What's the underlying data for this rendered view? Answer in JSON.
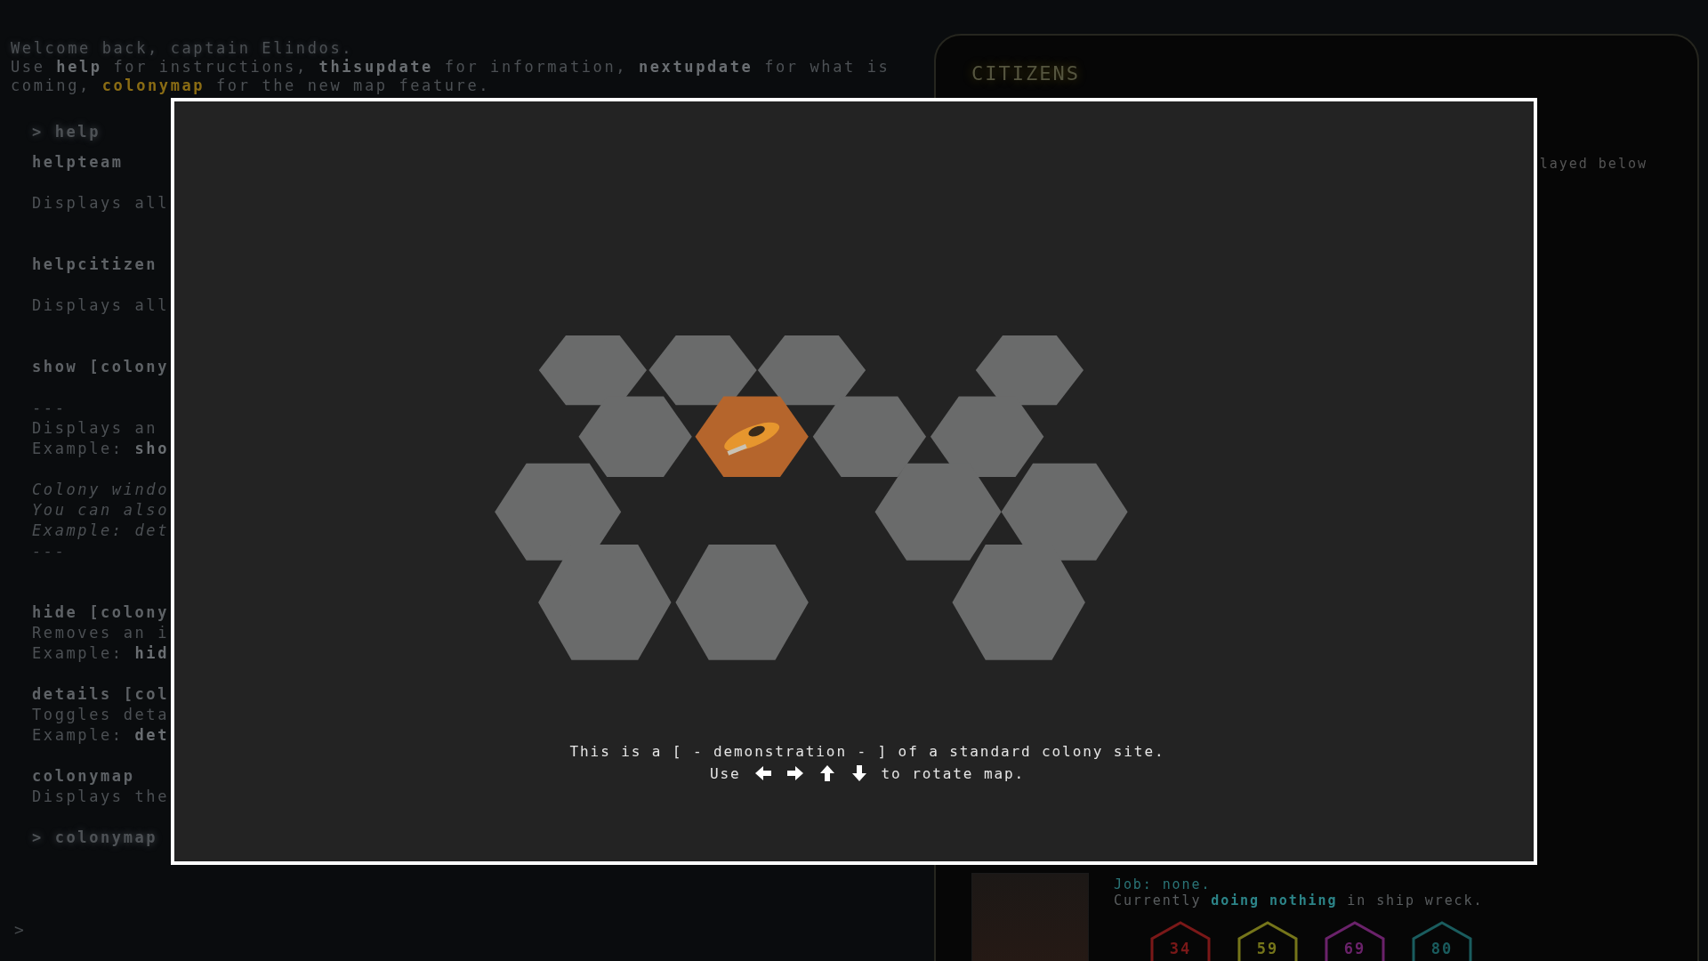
{
  "terminal": {
    "intro": [
      "Welcome back, captain Elindos.",
      "Use **help** for instructions, **thisupdate** for information, **nextupdate** for what is"
    ],
    "intro_last": {
      "prefix": "coming, ",
      "link": "colonymap",
      "suffix": " for the new map feature."
    },
    "echo": "> help",
    "sections": [
      {
        "kind": "spaced",
        "title": "helpteam",
        "paragraphs": [
          {
            "kind": "plain",
            "lines": [
              "Displays all"
            ]
          }
        ]
      },
      {
        "kind": "spaced",
        "title": "helpcitizen",
        "paragraphs": [
          {
            "kind": "plain",
            "lines": [
              "Displays all"
            ]
          }
        ]
      },
      {
        "kind": "spaced",
        "title": "show [colony",
        "paragraphs": [
          {
            "kind": "plain",
            "lines": [
              "---",
              "Displays an",
              "Example: **sho**"
            ]
          },
          {
            "kind": "italic",
            "lines": [
              "Colony windo",
              "You can also",
              "Example: det",
              "---"
            ]
          }
        ]
      },
      {
        "kind": "compact",
        "title": "hide [colony",
        "paragraphs": [
          {
            "kind": "plain",
            "lines": [
              "Removes an i",
              "Example: **hid**"
            ]
          }
        ]
      },
      {
        "kind": "compact",
        "title": "details [col",
        "paragraphs": [
          {
            "kind": "plain",
            "lines": [
              "Toggles deta",
              "Example: **det**"
            ]
          }
        ]
      },
      {
        "kind": "compact",
        "title": "colonymap",
        "paragraphs": [
          {
            "kind": "plain",
            "lines": [
              "Displays the"
            ]
          }
        ]
      }
    ],
    "last_echo": "> colonymap",
    "prompt": ">"
  },
  "citizens": {
    "title": "CITIZENS",
    "note": "layed below",
    "citizen": {
      "job": "Job: none.",
      "status": {
        "prefix": "Currently ",
        "activity": "doing nothing",
        "suffix": " in ship wreck."
      },
      "stats": [
        {
          "value": "34",
          "color": "#7a1818"
        },
        {
          "value": "59",
          "color": "#75751a"
        },
        {
          "value": "69",
          "color": "#6a226a"
        },
        {
          "value": "80",
          "color": "#1a5c5e"
        }
      ]
    }
  },
  "modal": {
    "caption": "This is a [ - demonstration - ] of a standard colony site.",
    "use": "Use",
    "rotate": "to rotate map."
  }
}
